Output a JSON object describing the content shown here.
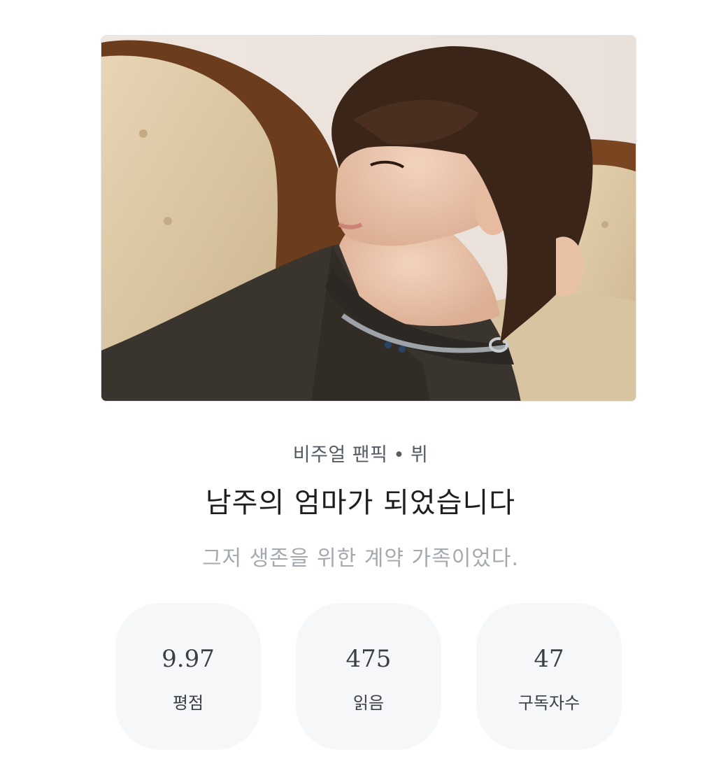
{
  "cover": {
    "icon": "cover-photo"
  },
  "meta": {
    "category": "비주얼 팬픽",
    "separator": "•",
    "character": "뷔"
  },
  "title": "남주의 엄마가 되었습니다",
  "subtitle": "그저 생존을 위한 계약 가족이었다.",
  "stats": [
    {
      "value": "9.97",
      "label": "평점"
    },
    {
      "value": "475",
      "label": "읽음"
    },
    {
      "value": "47",
      "label": "구독자수"
    }
  ],
  "colors": {
    "stat_bg": "#f6f7f9",
    "title": "#1c1e21",
    "subtitle": "#a4a9b0"
  }
}
